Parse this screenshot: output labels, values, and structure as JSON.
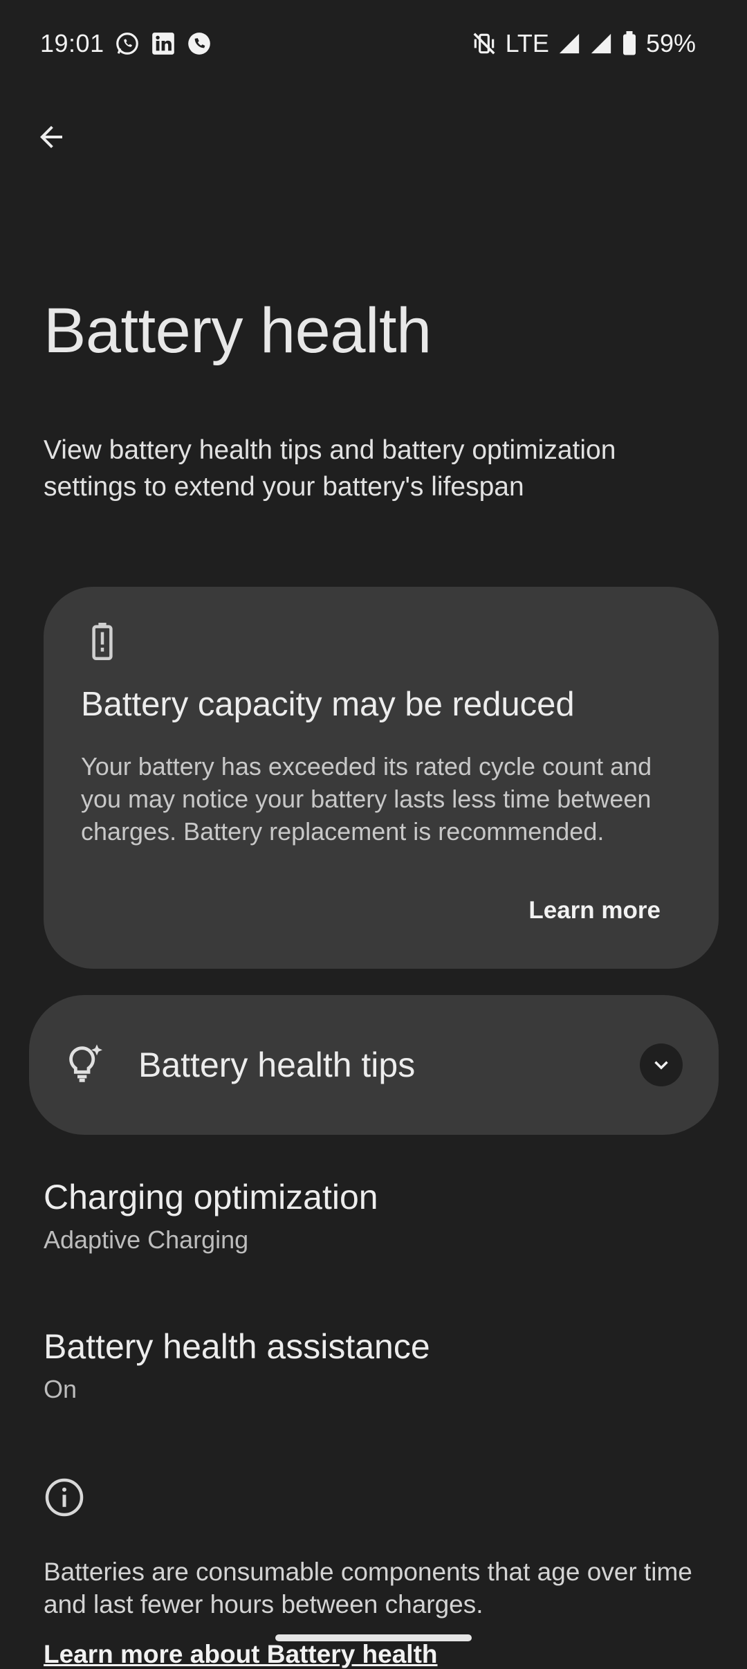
{
  "status_bar": {
    "time": "19:01",
    "network": "LTE",
    "battery_percent": "59%",
    "left_icons": [
      "whatsapp-icon",
      "linkedin-icon",
      "phone-app-icon"
    ],
    "right_icons": [
      "vibrate-off-icon",
      "signal-icon",
      "signal-icon",
      "battery-icon"
    ]
  },
  "header": {
    "back_icon": "arrow-back-icon",
    "title": "Battery health",
    "description": "View battery health tips and battery optimization settings to extend your battery's lifespan"
  },
  "warning_card": {
    "icon": "battery-alert-icon",
    "title": "Battery capacity may be reduced",
    "body": "Your battery has exceeded its rated cycle count and you may notice your battery lasts less time between charges. Battery replacement is recommended.",
    "action_label": "Learn more"
  },
  "tips": {
    "icon": "lightbulb-sparkle-icon",
    "label": "Battery health tips",
    "expand_icon": "chevron-down-icon"
  },
  "settings": [
    {
      "title": "Charging optimization",
      "summary": "Adaptive Charging"
    },
    {
      "title": "Battery health assistance",
      "summary": "On"
    }
  ],
  "footer": {
    "icon": "info-icon",
    "text": "Batteries are consumable components that age over time and last fewer hours between charges.",
    "link_label": "Learn more about Battery health"
  },
  "colors": {
    "background": "#1f1f1f",
    "card": "#3a3a3a",
    "text_primary": "#ededed",
    "text_secondary": "#bdbdbd"
  }
}
